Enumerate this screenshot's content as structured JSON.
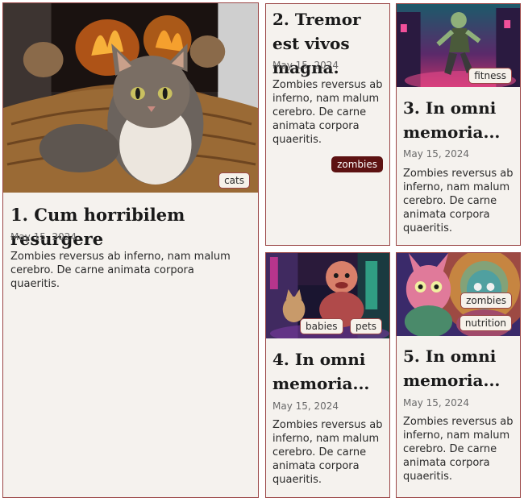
{
  "cards": [
    {
      "title": "1. Cum horribilem resurgere",
      "date": "May 15, 2024",
      "excerpt": "Zombies reversus ab inferno, nam malum cerebro. De carne animata corpora quaeritis.",
      "tags": [
        "cats"
      ],
      "image": "cat-in-basket-by-fireplace"
    },
    {
      "title": "2. Tremor est vivos magna.",
      "date": "May 15, 2024",
      "excerpt": "Zombies reversus ab inferno, nam malum cerebro. De carne animata corpora quaeritis.",
      "tags": [
        "zombies"
      ]
    },
    {
      "title": "3. In omni memoria...",
      "date": "May 15, 2024",
      "excerpt": "Zombies reversus ab inferno, nam malum cerebro. De carne animata corpora quaeritis.",
      "tags": [
        "fitness"
      ],
      "image": "zombie-running-neon-city"
    },
    {
      "title": "4. In omni memoria...",
      "date": "May 15, 2024",
      "excerpt": "Zombies reversus ab inferno, nam malum cerebro. De carne animata corpora quaeritis.",
      "tags": [
        "babies",
        "pets"
      ],
      "image": "baby-and-dog-neon-alley"
    },
    {
      "title": "5. In omni memoria...",
      "date": "May 15, 2024",
      "excerpt": "Zombies reversus ab inferno, nam malum cerebro. De carne animata corpora quaeritis.",
      "tags": [
        "zombies",
        "nutrition"
      ],
      "image": "cartoon-zombie-creatures-eating"
    }
  ],
  "colors": {
    "card_background": "#f5f2ee",
    "card_border": "#9b4747",
    "dark_tag": "#5d1212"
  }
}
